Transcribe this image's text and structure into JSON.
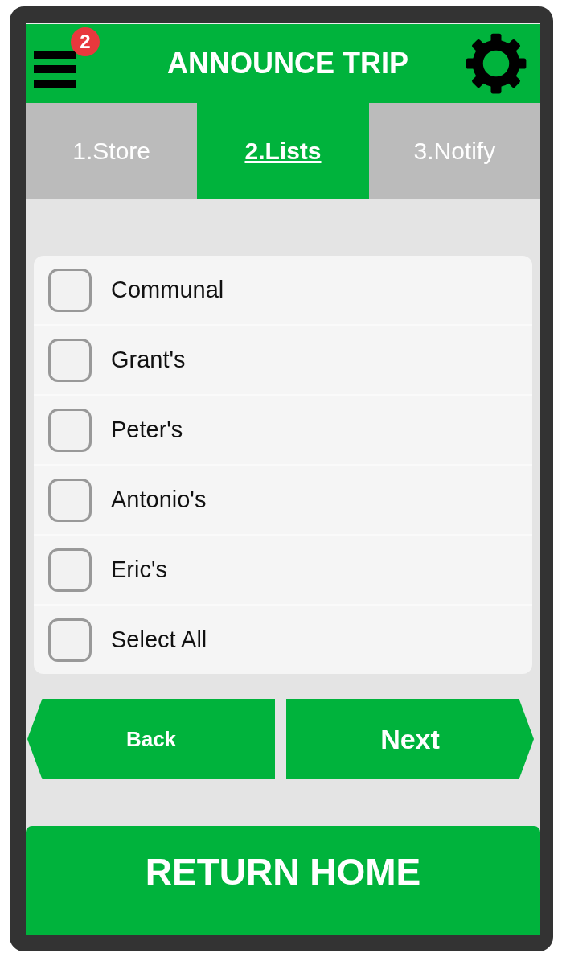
{
  "header": {
    "title": "ANNOUNCE TRIP",
    "menu_badge": "2"
  },
  "tabs": [
    {
      "label": "1.Store",
      "selected": false
    },
    {
      "label": "2.Lists",
      "selected": true
    },
    {
      "label": "3.Notify",
      "selected": false
    }
  ],
  "lists": [
    {
      "label": "Communal",
      "checked": false
    },
    {
      "label": "Grant's",
      "checked": false
    },
    {
      "label": "Peter's",
      "checked": false
    },
    {
      "label": "Antonio's",
      "checked": false
    },
    {
      "label": "Eric's",
      "checked": false
    },
    {
      "label": "Select All",
      "checked": false
    }
  ],
  "nav_buttons": [
    {
      "label": "Back",
      "kind": "back"
    },
    {
      "label": "Next",
      "kind": "next"
    }
  ],
  "home_button": "RETURN HOME"
}
